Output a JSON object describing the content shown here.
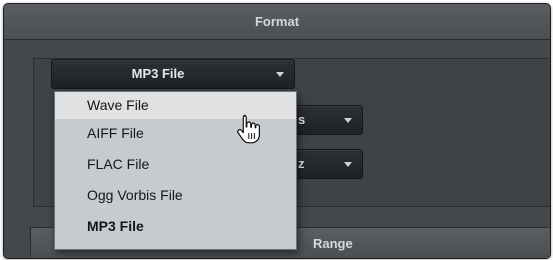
{
  "format_section": {
    "title": "Format"
  },
  "format_select": {
    "value": "MP3 File"
  },
  "dropdown": {
    "items": [
      {
        "label": "Wave File"
      },
      {
        "label": "AIFF File"
      },
      {
        "label": "FLAC File"
      },
      {
        "label": "Ogg Vorbis File"
      },
      {
        "label": "MP3 File"
      }
    ],
    "selected": "MP3 File",
    "hovered": "Wave File"
  },
  "hidden_selects": {
    "first_visible_text": "s",
    "second_visible_text": "z"
  },
  "range_section": {
    "title_visible": "Range"
  },
  "icons": {
    "dropdown_arrow": "chevron-down-icon",
    "cursor": "hand-pointer-icon"
  }
}
